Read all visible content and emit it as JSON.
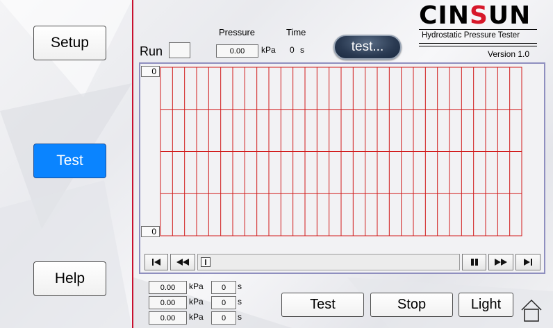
{
  "nav": {
    "setup_label": "Setup",
    "test_label": "Test",
    "help_label": "Help"
  },
  "header": {
    "run_label": "Run",
    "pressure_label": "Pressure",
    "pressure_value": "0.00",
    "pressure_unit": "kPa",
    "time_label": "Time",
    "time_value": "0",
    "time_unit": "s",
    "status_button": "test..."
  },
  "brand": {
    "logo_part1": "CIN",
    "logo_part2": "S",
    "logo_part3": "UN",
    "subtitle": "Hydrostatic Pressure Tester",
    "version": "Version 1.0",
    "accent_color": "#d7182a"
  },
  "chart": {
    "y_top_label": "0",
    "y_bottom_label": "0",
    "grid_color": "#d11a1a",
    "columns": 30,
    "rows": 4
  },
  "readings": [
    {
      "pressure": "0.00",
      "pressure_unit": "kPa",
      "time": "0",
      "time_unit": "s"
    },
    {
      "pressure": "0.00",
      "pressure_unit": "kPa",
      "time": "0",
      "time_unit": "s"
    },
    {
      "pressure": "0.00",
      "pressure_unit": "kPa",
      "time": "0",
      "time_unit": "s"
    }
  ],
  "actions": {
    "test_label": "Test",
    "stop_label": "Stop",
    "light_label": "Light"
  },
  "icons": {
    "first": "skip-to-start-icon",
    "rewind": "rewind-icon",
    "pause": "pause-icon",
    "forward": "fast-forward-icon",
    "last": "skip-to-end-icon",
    "home": "home-icon"
  }
}
